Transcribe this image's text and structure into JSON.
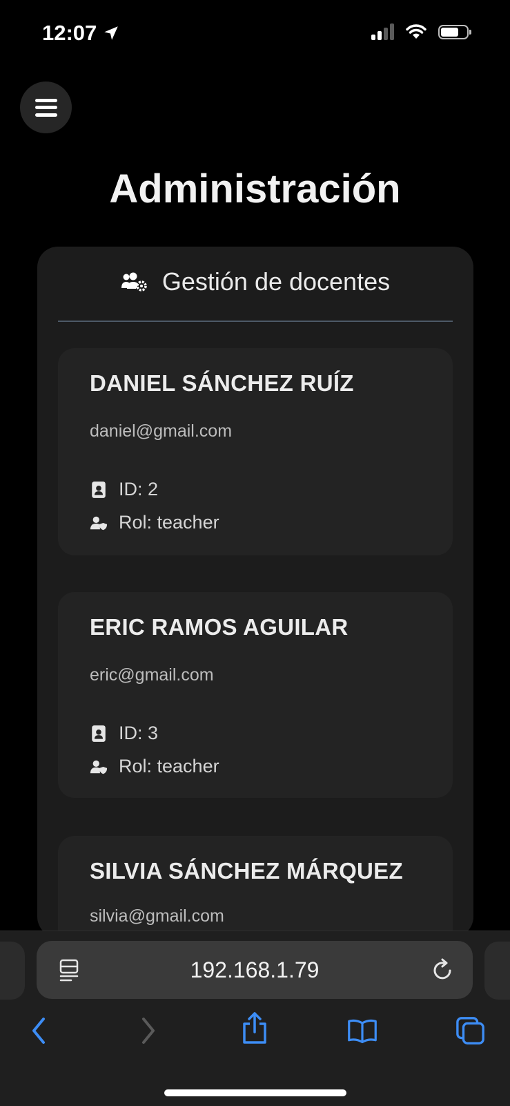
{
  "status_bar": {
    "time": "12:07"
  },
  "page": {
    "title": "Administración"
  },
  "panel": {
    "title": "Gestión de docentes",
    "teachers": [
      {
        "name": "DANIEL SÁNCHEZ RUÍZ",
        "email": "daniel@gmail.com",
        "id_text": "ID: 2",
        "role_text": "Rol: teacher"
      },
      {
        "name": "ERIC RAMOS AGUILAR",
        "email": "eric@gmail.com",
        "id_text": "ID: 3",
        "role_text": "Rol: teacher"
      },
      {
        "name": "SILVIA SÁNCHEZ MÁRQUEZ",
        "email": "silvia@gmail.com"
      }
    ]
  },
  "browser": {
    "url": "192.168.1.79"
  },
  "colors": {
    "background": "#000000",
    "panel": "#1c1c1c",
    "card": "#232323",
    "accent": "#3d8df5"
  }
}
